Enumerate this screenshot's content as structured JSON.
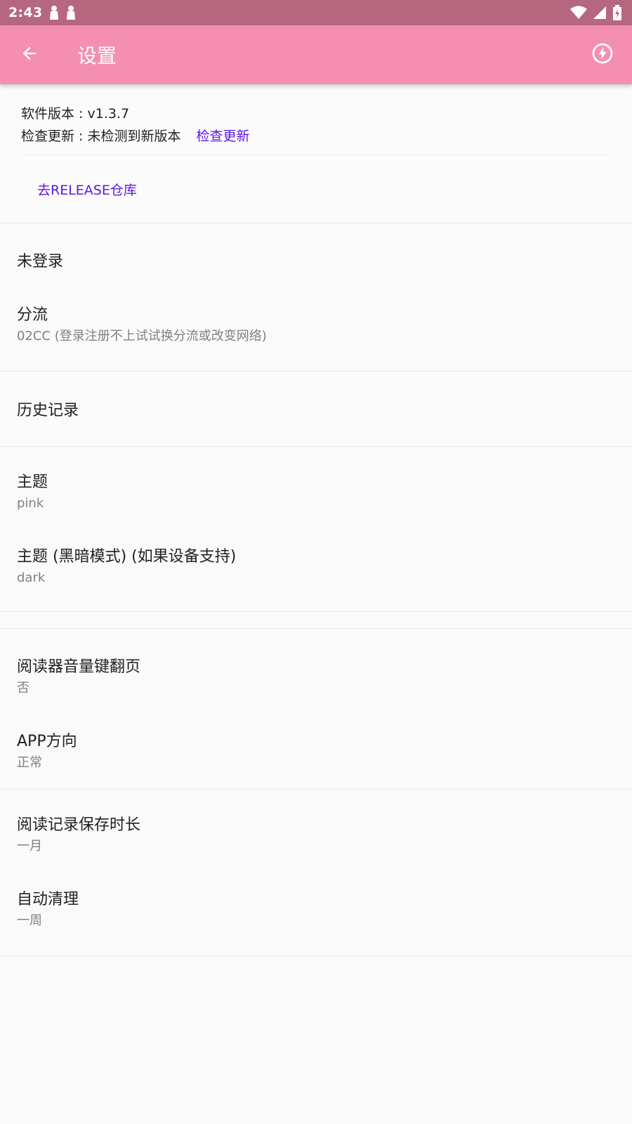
{
  "status_bar": {
    "time": "2:43",
    "icons": [
      "notification-figure-icon",
      "notification-figure-icon",
      "wifi-icon",
      "cell-signal-icon",
      "battery-charging-icon"
    ]
  },
  "app_bar": {
    "title": "设置",
    "back_icon": "arrow-back-icon",
    "action_icon": "lightning-circle-icon",
    "color": "#f48fb1"
  },
  "version": {
    "label_version": "软件版本 : v1.3.7",
    "label_update": "检查更新 : 未检测到新版本",
    "check_update_link": "检查更新",
    "release_link": "去RELEASE仓库",
    "link_color": "#5b1ae0"
  },
  "account": {
    "login_status": "未登录",
    "route_title": "分流",
    "route_sub": "02CC (登录注册不上试试换分流或改变网络)"
  },
  "history": {
    "title": "历史记录"
  },
  "theme": {
    "title": "主题",
    "value": "pink",
    "dark_title": "主题 (黑暗模式) (如果设备支持)",
    "dark_value": "dark"
  },
  "reader": {
    "volume_title": "阅读器音量键翻页",
    "volume_value": "否",
    "orientation_title": "APP方向",
    "orientation_value": "正常"
  },
  "records": {
    "keep_title": "阅读记录保存时长",
    "keep_value": "一月",
    "clean_title": "自动清理",
    "clean_value": "一周"
  }
}
